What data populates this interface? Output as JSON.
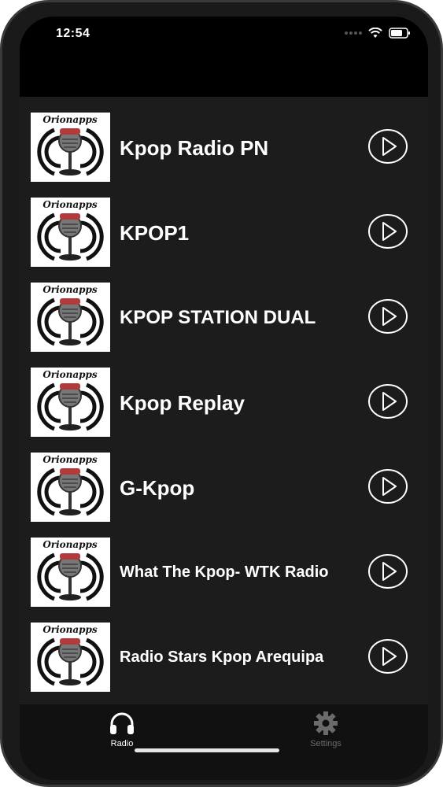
{
  "status_bar": {
    "time": "12:54"
  },
  "app": {
    "logo_text": "Orionapps"
  },
  "stations": [
    {
      "name": "Kpop Radio PN"
    },
    {
      "name": "KPOP1"
    },
    {
      "name": "KPOP STATION DUAL"
    },
    {
      "name": "Kpop Replay"
    },
    {
      "name": "G-Kpop"
    },
    {
      "name": "What The Kpop- WTK Radio"
    },
    {
      "name": "Radio Stars Kpop Arequipa"
    }
  ],
  "partial_station": {
    "logo_text": "Orionapps"
  },
  "tab_bar": {
    "tabs": [
      {
        "label": "Radio",
        "icon": "headphones-icon",
        "active": true
      },
      {
        "label": "Settings",
        "icon": "gear-icon",
        "active": false
      }
    ]
  },
  "colors": {
    "background": "#1c1c1c",
    "text": "#ffffff",
    "tab_active": "#ffffff",
    "tab_inactive": "#6b6b6b"
  }
}
